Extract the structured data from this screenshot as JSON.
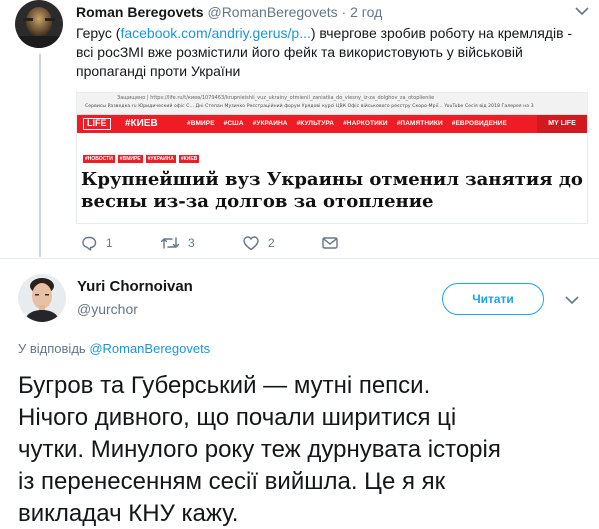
{
  "parent_tweet": {
    "name": "Roman Beregovets",
    "handle": "@RomanBeregovets",
    "separator": "·",
    "time": "2 год",
    "text_before_link": "Герус (",
    "link": "facebook.com/andriy.gerus/p...",
    "text_after_link": ") вчергове зробив роботу на кремлядів - всі росЗМІ вже розмістили його фейк та використовують у військовій пропаганді проти України",
    "embed": {
      "url": "Защищено | https://life.ru/t/киев/1079463/krupnieishii_vuz_ukrainy_otmienil_zaniatiia_do_viesny_iz-za_dolghov_za_otoplieniie",
      "bookmarks": "Сервисы  Разведка.ru   Юридический офіс С...   Дні Степан Музичко   Реєстраційний форум   Урядові курсі ЦВК   Офіс військового реєстру   Скоро-Мрії...   YouTube   Сесія від 2018   Галерея на 3",
      "logo": "LIFE",
      "section": "#КИЕВ",
      "nav_items": [
        "#ВМИРЕ",
        "#США",
        "#УКРАИНА",
        "#КУЛЬТУРА",
        "#НАРКОТИКИ",
        "#ПАМЯТНИКИ",
        "#ЕВРОВИДЕНИЕ"
      ],
      "mylife": "MY LIFE",
      "tags": [
        "#НОВОСТИ",
        "#ВМИРЕ",
        "#УКРАИНА",
        "#КИЕВ"
      ],
      "headline": "Крупнейший вуз Украины отменил занятия до весны из-за долгов за отопление"
    },
    "actions": {
      "replies": "1",
      "retweets": "3",
      "likes": "2"
    }
  },
  "main_tweet": {
    "name": "Yuri Chornoivan",
    "handle": "@yurchor",
    "follow_label": "Читати",
    "reply_prefix": "У відповідь",
    "reply_handle": "@RomanBeregovets",
    "text": "Бугров та Губерський — мутні пепси.\nНічого дивного, що почали ширитися ці\nчутки. Минулого року теж дурнувата історія\nіз перенесенням сесії вийшла. Це я як\nвикладач КНУ кажу."
  },
  "icons": [
    "reply-icon",
    "retweet-icon",
    "like-icon",
    "message-icon",
    "chevron-down-icon"
  ],
  "colors": {
    "link": "#1b95e0",
    "accent": "#1da1f2",
    "secondary_text": "#657786",
    "life_red": "#ee1c25"
  }
}
